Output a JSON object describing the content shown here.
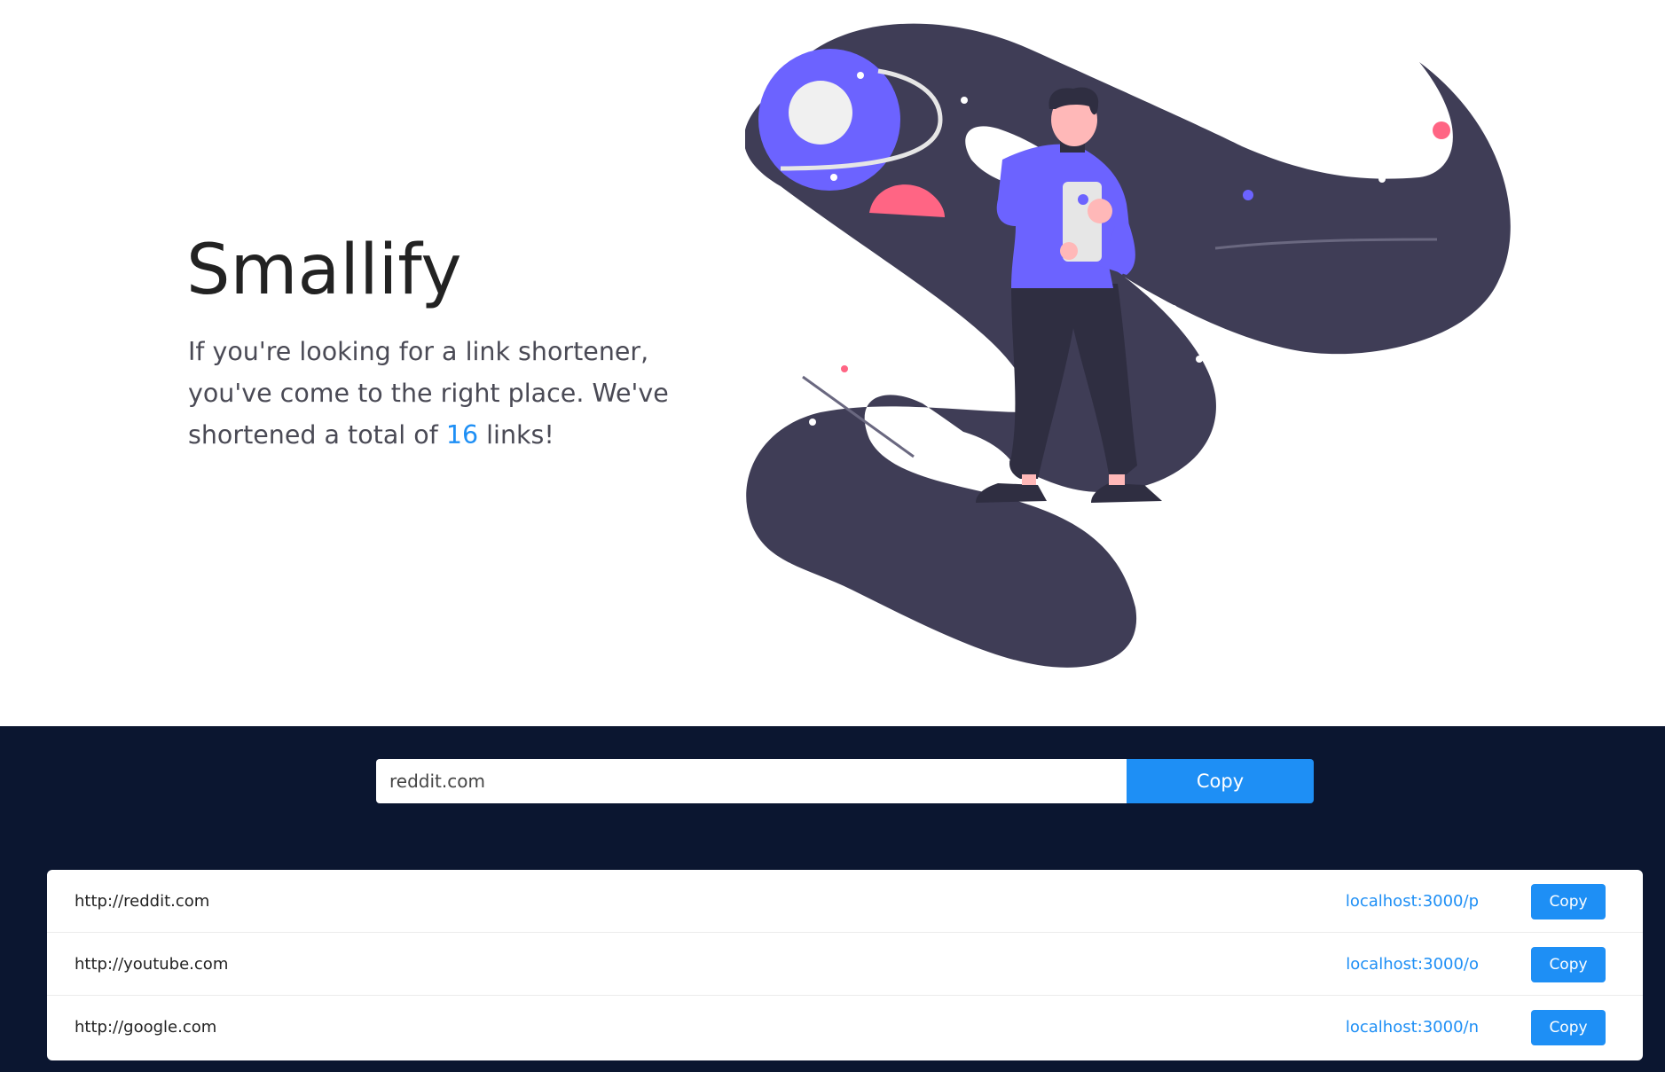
{
  "hero": {
    "title": "Smallify",
    "desc_before": "If you're looking for a link shortener, you've come to the right place. We've shortened a total of ",
    "count": "16",
    "desc_after": " links!"
  },
  "form": {
    "input_value": "reddit.com",
    "button_label": "Copy"
  },
  "links": [
    {
      "original": "http://reddit.com",
      "short": "localhost:3000/p",
      "copy_label": "Copy"
    },
    {
      "original": "http://youtube.com",
      "short": "localhost:3000/o",
      "copy_label": "Copy"
    },
    {
      "original": "http://google.com",
      "short": "localhost:3000/n",
      "copy_label": "Copy"
    }
  ],
  "colors": {
    "accent": "#1e8ff5",
    "dark_bg": "#0b1630",
    "space_blob": "#3f3d56",
    "planet": "#6c63ff",
    "pink": "#ff6584"
  }
}
